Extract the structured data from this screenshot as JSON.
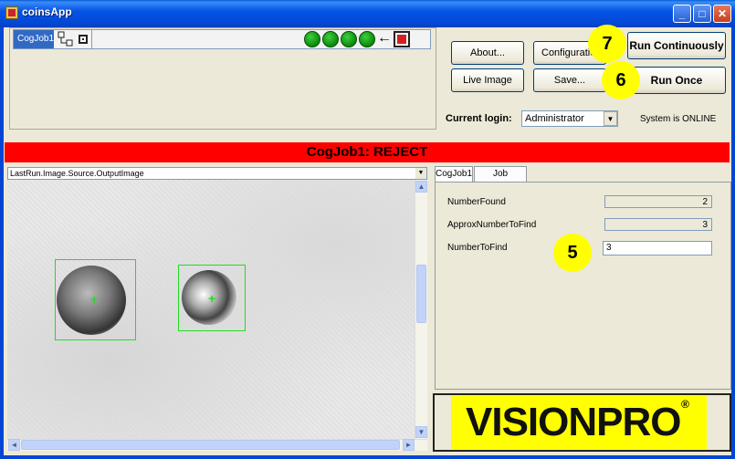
{
  "window": {
    "title": "coinsApp",
    "minimize": "_",
    "maximize": "□",
    "close": "✕"
  },
  "job_toolbar": {
    "job_name": "CogJob1",
    "status_lights": 4,
    "arrow": "←"
  },
  "buttons": {
    "about": "About...",
    "configuration": "Configuration",
    "live_image": "Live Image",
    "save": "Save...",
    "run_continuously": "Run Continuously",
    "run_once": "Run Once"
  },
  "login": {
    "label": "Current login:",
    "value": "Administrator",
    "system_status": "System is ONLINE"
  },
  "status_bar": {
    "text": "CogJob1: REJECT",
    "color": "#ff0000"
  },
  "image_panel": {
    "source": "LastRun.Image.Source.OutputImage"
  },
  "tabs": [
    {
      "label": "CogJob1"
    },
    {
      "label": "Job Statistics"
    }
  ],
  "fields": [
    {
      "label": "NumberFound",
      "value": "2"
    },
    {
      "label": "ApproxNumberToFind",
      "value": "3"
    },
    {
      "label": "NumberToFind",
      "value": "3"
    }
  ],
  "logo": {
    "text": "VISIONPRO",
    "reg": "®"
  },
  "callouts": {
    "c7": "7",
    "c6": "6",
    "c5": "5"
  },
  "colors": {
    "title_bar": "#0346d4",
    "status_reject": "#ff0000",
    "logo_bg": "#ffff00",
    "detection_box": "#22dd22"
  }
}
